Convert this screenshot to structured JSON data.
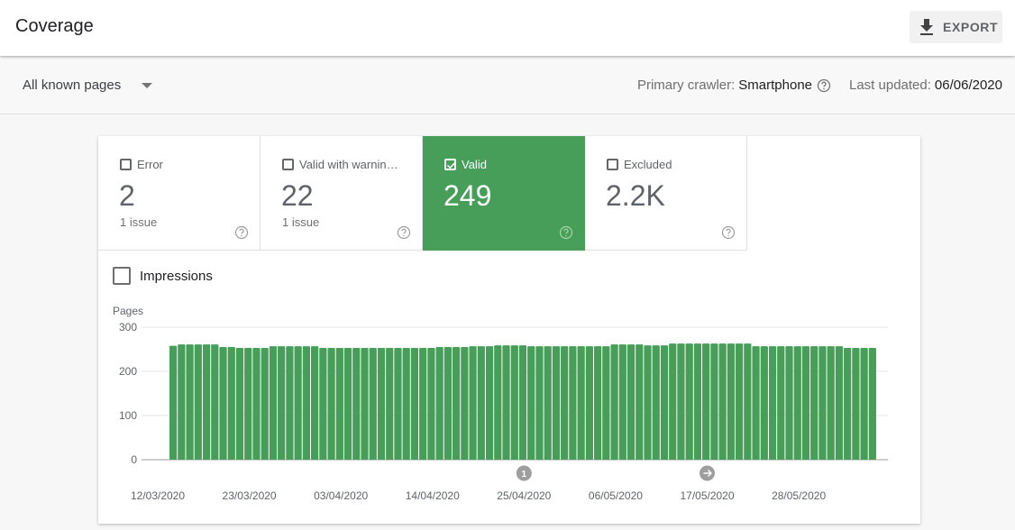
{
  "header": {
    "title": "Coverage",
    "export_label": "EXPORT",
    "export_icon": "download-icon"
  },
  "filter": {
    "dropdown_value": "All known pages",
    "primary_crawler_label": "Primary crawler:",
    "primary_crawler_value": "Smartphone",
    "last_updated_label": "Last updated:",
    "last_updated_value": "06/06/2020"
  },
  "tiles": [
    {
      "label": "Error",
      "value": "2",
      "sub": "1 issue",
      "checked": false
    },
    {
      "label": "Valid with warnin…",
      "value": "22",
      "sub": "1 issue",
      "checked": false
    },
    {
      "label": "Valid",
      "value": "249",
      "sub": "",
      "checked": true
    },
    {
      "label": "Excluded",
      "value": "2.2K",
      "sub": "",
      "checked": false
    }
  ],
  "impressions": {
    "label": "Impressions",
    "checked": false
  },
  "colors": {
    "valid_green": "#469e58",
    "marker_gray": "#9e9e9e"
  },
  "chart_data": {
    "type": "bar",
    "title": "",
    "ylabel": "Pages",
    "xlabel": "",
    "ylim": [
      0,
      300
    ],
    "yticks": [
      0,
      100,
      200,
      300
    ],
    "grid": true,
    "series": [
      {
        "name": "Valid",
        "color": "#469e58"
      }
    ],
    "start_date": "12/03/2020",
    "end_date": "04/06/2020",
    "xtick_labels": [
      "12/03/2020",
      "23/03/2020",
      "03/04/2020",
      "14/04/2020",
      "25/04/2020",
      "06/05/2020",
      "17/05/2020",
      "28/05/2020"
    ],
    "values": [
      258,
      261,
      261,
      261,
      261,
      261,
      255,
      255,
      253,
      253,
      253,
      253,
      257,
      257,
      257,
      257,
      257,
      257,
      253,
      253,
      253,
      253,
      253,
      253,
      253,
      253,
      253,
      253,
      253,
      253,
      253,
      253,
      255,
      255,
      255,
      255,
      257,
      257,
      257,
      259,
      259,
      259,
      259,
      257,
      257,
      257,
      257,
      257,
      257,
      257,
      257,
      257,
      257,
      261,
      261,
      261,
      261,
      259,
      259,
      259,
      263,
      263,
      263,
      263,
      263,
      263,
      263,
      263,
      263,
      263,
      257,
      257,
      257,
      257,
      257,
      257,
      257,
      257,
      257,
      257,
      257,
      253,
      253,
      253,
      253
    ],
    "annotations": [
      {
        "label": "1",
        "type": "number",
        "date": "25/04/2020"
      },
      {
        "label": "→",
        "type": "arrow",
        "date": "17/05/2020"
      }
    ]
  }
}
